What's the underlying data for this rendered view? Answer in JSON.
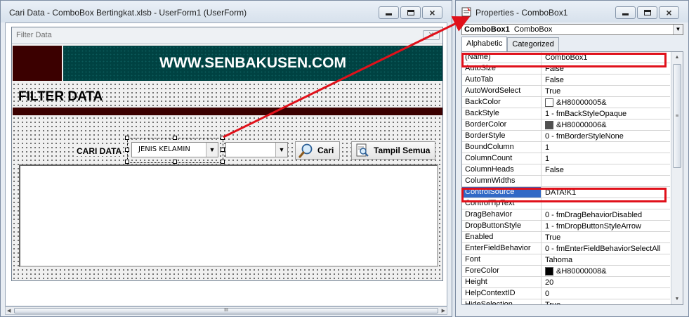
{
  "userform_window": {
    "title": "Cari Data - ComboBox Bertingkat.xlsb - UserForm1 (UserForm)"
  },
  "form": {
    "caption": "Filter Data",
    "close_glyph": "✕",
    "banner_text": "WWW.SENBAKUSEN.COM",
    "heading": "FILTER DATA",
    "search_label": "CARI DATA",
    "combo1_value": "JENIS KELAMIN",
    "combo2_value": "",
    "btn_cari": "Cari",
    "btn_tampil": "Tampil Semua",
    "scroll_grip": "III"
  },
  "properties_window": {
    "title": "Properties - ComboBox1",
    "object_name": "ComboBox1",
    "object_type": "ComboBox",
    "tabs": [
      "Alphabetic",
      "Categorized"
    ],
    "active_tab": "Alphabetic"
  },
  "properties": [
    {
      "name": "(Name)",
      "value": "ComboBox1"
    },
    {
      "name": "AutoSize",
      "value": "False"
    },
    {
      "name": "AutoTab",
      "value": "False"
    },
    {
      "name": "AutoWordSelect",
      "value": "True"
    },
    {
      "name": "BackColor",
      "value": "&H80000005&",
      "swatch": "#ffffff"
    },
    {
      "name": "BackStyle",
      "value": "1 - fmBackStyleOpaque"
    },
    {
      "name": "BorderColor",
      "value": "&H80000006&",
      "swatch": "#505050"
    },
    {
      "name": "BorderStyle",
      "value": "0 - fmBorderStyleNone"
    },
    {
      "name": "BoundColumn",
      "value": "1"
    },
    {
      "name": "ColumnCount",
      "value": "1"
    },
    {
      "name": "ColumnHeads",
      "value": "False"
    },
    {
      "name": "ColumnWidths",
      "value": ""
    },
    {
      "name": "ControlSource",
      "value": "DATA!K1",
      "selected": true
    },
    {
      "name": "ControlTipText",
      "value": ""
    },
    {
      "name": "DragBehavior",
      "value": "0 - fmDragBehaviorDisabled"
    },
    {
      "name": "DropButtonStyle",
      "value": "1 - fmDropButtonStyleArrow"
    },
    {
      "name": "Enabled",
      "value": "True"
    },
    {
      "name": "EnterFieldBehavior",
      "value": "0 - fmEnterFieldBehaviorSelectAll"
    },
    {
      "name": "Font",
      "value": "Tahoma"
    },
    {
      "name": "ForeColor",
      "value": "&H80000008&",
      "swatch": "#000000"
    },
    {
      "name": "Height",
      "value": "20"
    },
    {
      "name": "HelpContextID",
      "value": "0"
    },
    {
      "name": "HideSelection",
      "value": "True"
    }
  ],
  "colors": {
    "highlight_red": "#e0101a",
    "banner_teal": "#004242",
    "maroon": "#3b0000",
    "selection_blue": "#3169c6"
  }
}
